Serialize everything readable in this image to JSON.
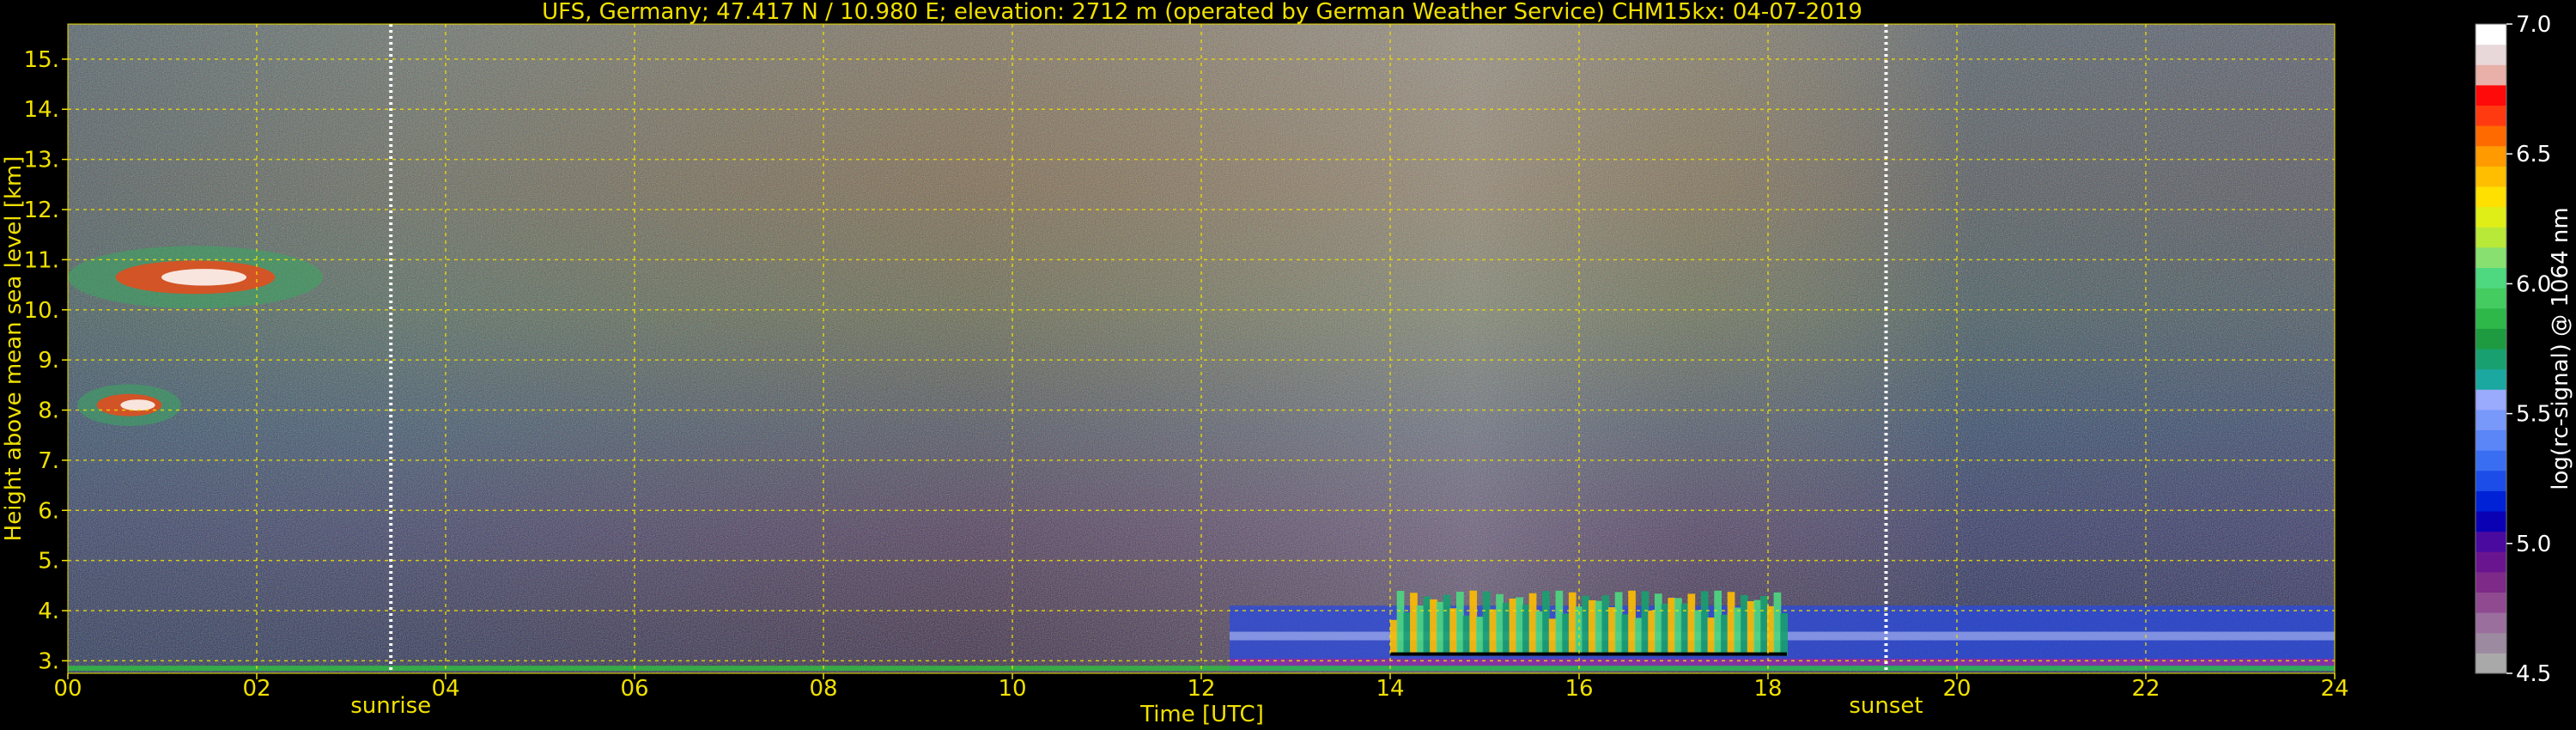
{
  "chart_data": {
    "type": "heatmap",
    "title": "UFS, Germany; 47.417 N / 10.980 E; elevation: 2712 m  (operated by German Weather Service)    CHM15kx: 04-07-2019",
    "xlabel": "Time [UTC]",
    "ylabel": "Height above mean sea level [km]",
    "xlim": [
      0,
      24
    ],
    "ylim": [
      2.75,
      15.7
    ],
    "x_ticks": [
      0,
      2,
      4,
      6,
      8,
      10,
      12,
      14,
      16,
      18,
      20,
      22,
      24
    ],
    "x_tick_labels": [
      "00",
      "02",
      "04",
      "06",
      "08",
      "10",
      "12",
      "14",
      "16",
      "18",
      "20",
      "22",
      "24"
    ],
    "y_ticks": [
      3,
      4,
      5,
      6,
      7,
      8,
      9,
      10,
      11,
      12,
      13,
      14,
      15
    ],
    "y_tick_labels": [
      "3.",
      "4.",
      "5.",
      "6.",
      "7.",
      "8.",
      "9.",
      "10.",
      "11.",
      "12.",
      "13.",
      "14.",
      "15."
    ],
    "grid": true,
    "markers": [
      {
        "label": "sunrise",
        "x": 3.42
      },
      {
        "label": "sunset",
        "x": 19.25
      }
    ],
    "colorbar": {
      "label": "log(rc-signal) @ 1064 nm",
      "range": [
        4.5,
        7.0
      ],
      "ticks": [
        4.5,
        5.0,
        5.5,
        6.0,
        6.5,
        7.0
      ],
      "tick_labels": [
        "4.5",
        "5.0",
        "5.5",
        "6.0",
        "6.5",
        "7.0"
      ],
      "colors": [
        "#a9a9a9",
        "#9c8aa0",
        "#9a6f9e",
        "#8f4a90",
        "#7d2a88",
        "#6a1590",
        "#4a0aa0",
        "#0a00b4",
        "#0022d6",
        "#1c4de8",
        "#3a6ef2",
        "#5a86f8",
        "#7898fa",
        "#9aaafc",
        "#1aa8a0",
        "#18a070",
        "#1e9a40",
        "#2eb84a",
        "#44cc60",
        "#4ed880",
        "#88e070",
        "#b8e838",
        "#e0ee18",
        "#ffe000",
        "#ffbe00",
        "#ff9a00",
        "#ff6a00",
        "#ff3a10",
        "#ff0a0a",
        "#e8b0a8",
        "#e8d8da",
        "#ffffff"
      ]
    },
    "features": [
      {
        "description": "cirrus",
        "x_range": [
          0.0,
          2.7
        ],
        "y_range": [
          9.9,
          11.4
        ],
        "level": 6.3
      },
      {
        "description": "cirrus",
        "x_range": [
          0.1,
          1.2
        ],
        "y_range": [
          7.6,
          8.6
        ],
        "level": 6.3
      },
      {
        "description": "boundary layer",
        "x_range": [
          12.3,
          24.0
        ],
        "y_range": [
          2.8,
          4.1
        ],
        "level": 5.2
      },
      {
        "description": "aerosol layer",
        "x_range": [
          14.0,
          18.2
        ],
        "y_range": [
          3.1,
          4.4
        ],
        "level": 6.4
      }
    ]
  }
}
